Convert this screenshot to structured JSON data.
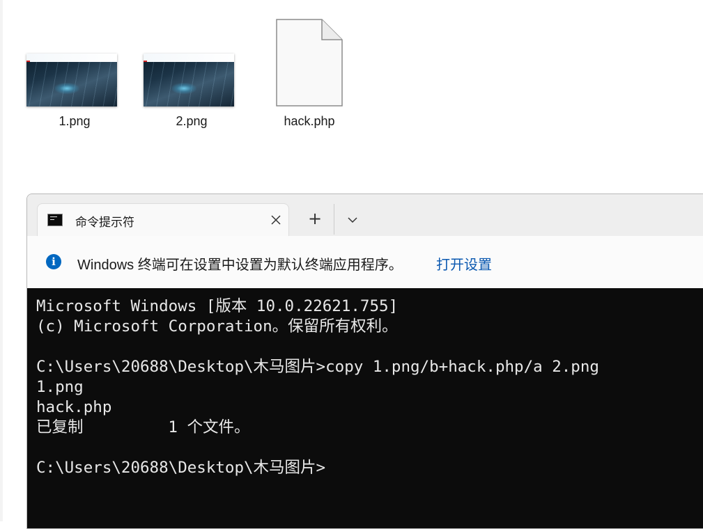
{
  "files": [
    {
      "name": "1.png",
      "type": "image",
      "icon": "image-thumbnail"
    },
    {
      "name": "2.png",
      "type": "image",
      "icon": "image-thumbnail"
    },
    {
      "name": "hack.php",
      "type": "document",
      "icon": "blank-file-icon"
    }
  ],
  "terminal": {
    "tab_title": "命令提示符",
    "new_tab_symbol": "+",
    "info_message": "Windows 终端可在设置中设置为默认终端应用程序。",
    "info_link": "打开设置",
    "lines": [
      "Microsoft Windows [版本 10.0.22621.755]",
      "(c) Microsoft Corporation。保留所有权利。",
      "",
      "C:\\Users\\20688\\Desktop\\木马图片>copy 1.png/b+hack.php/a 2.png",
      "1.png",
      "hack.php",
      "已复制         1 个文件。",
      "",
      "C:\\Users\\20688\\Desktop\\木马图片>"
    ]
  },
  "colors": {
    "console_bg": "#0c0c0c",
    "console_text": "#e8e8e8",
    "accent": "#0067c0",
    "link": "#0a58b0"
  }
}
